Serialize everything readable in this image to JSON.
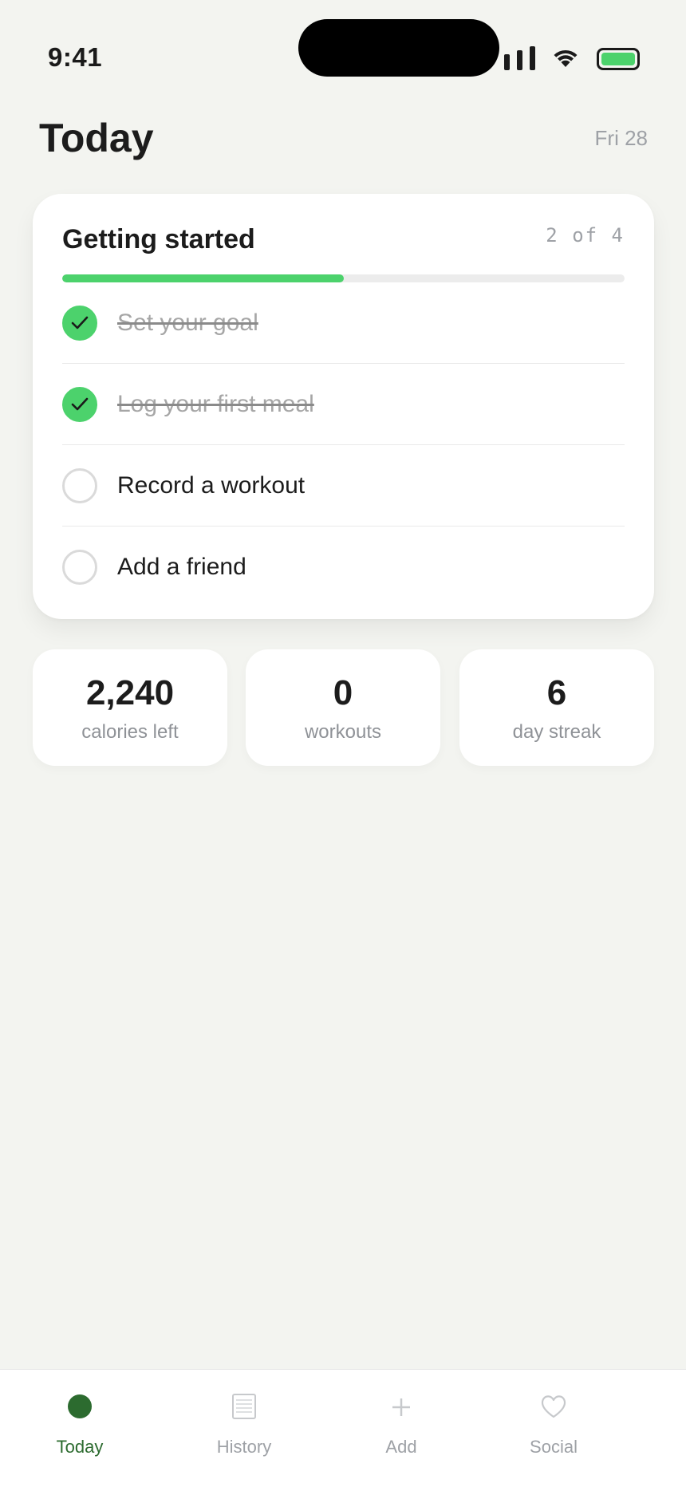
{
  "status_bar": {
    "time": "9:41"
  },
  "header": {
    "title": "Today",
    "date": "Fri 28"
  },
  "onboarding": {
    "title": "Getting started",
    "count": "2 of 4",
    "progress_fraction": 0.5,
    "colors": {
      "accent": "#4cd26c"
    },
    "items": [
      {
        "label": "Set your goal",
        "done": true
      },
      {
        "label": "Log your first meal",
        "done": true
      },
      {
        "label": "Record a workout",
        "done": false
      },
      {
        "label": "Add a friend",
        "done": false
      }
    ]
  },
  "stats": [
    {
      "value": "2,240",
      "label": "calories left"
    },
    {
      "value": "0",
      "label": "workouts"
    },
    {
      "value": "6",
      "label": "day streak"
    }
  ],
  "tabbar": {
    "active_color": "#2c6b2f",
    "tabs": [
      {
        "label": "Today",
        "icon": "dot-icon",
        "active": true
      },
      {
        "label": "History",
        "icon": "list-icon",
        "active": false
      },
      {
        "label": "Add",
        "icon": "plus-icon",
        "active": false
      },
      {
        "label": "Social",
        "icon": "heart-icon",
        "active": false
      }
    ]
  }
}
